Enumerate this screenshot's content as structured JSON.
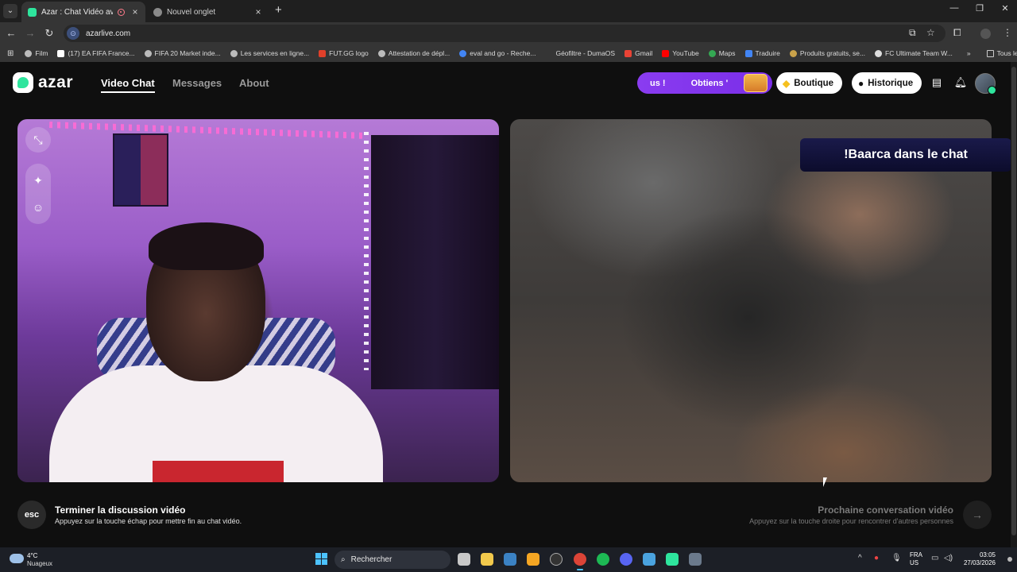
{
  "browser": {
    "tabs": [
      {
        "title": "Azar : Chat Vidéo avec de n",
        "active": true
      },
      {
        "title": "Nouvel onglet",
        "active": false
      }
    ],
    "url": "azarlive.com",
    "bookmarks": [
      "Film",
      "(17) EA FIFA France...",
      "FIFA 20 Market inde...",
      "Les services en ligne...",
      "FUT.GG logo",
      "Attestation de dépl...",
      "eval and go - Reche...",
      "Géofiltre - DumaOS",
      "Gmail",
      "YouTube",
      "Maps",
      "Traduire",
      "Produits gratuits, se...",
      "FC Ultimate Team W..."
    ],
    "all_bookmarks_label": "Tous les favoris"
  },
  "header": {
    "logo_text": "azar",
    "nav": [
      "Video Chat",
      "Messages",
      "About"
    ],
    "promo": {
      "left_text": "us !",
      "right_text": "Obtiens '"
    },
    "boutique_label": "Boutique",
    "historique_label": "Historique"
  },
  "remote_overlay_text": "!Baarca dans le chat",
  "controls": {
    "esc_key": "esc",
    "end_title": "Terminer la discussion vidéo",
    "end_subtitle": "Appuyez sur la touche échap pour mettre fin au chat vidéo.",
    "next_title": "Prochaine conversation vidéo",
    "next_subtitle": "Appuyez sur la touche droite pour rencontrer d'autres personnes"
  },
  "taskbar": {
    "temperature": "4°C",
    "weather": "Nuageux",
    "search_placeholder": "Rechercher",
    "lang_line1": "FRA",
    "lang_line2": "US",
    "time": "03:05",
    "date": "27/03/2026"
  },
  "colors": {
    "accent_green": "#2ee59d",
    "promo_purple": "#8a3cf0",
    "banner_navy": "#1a1a4a"
  }
}
